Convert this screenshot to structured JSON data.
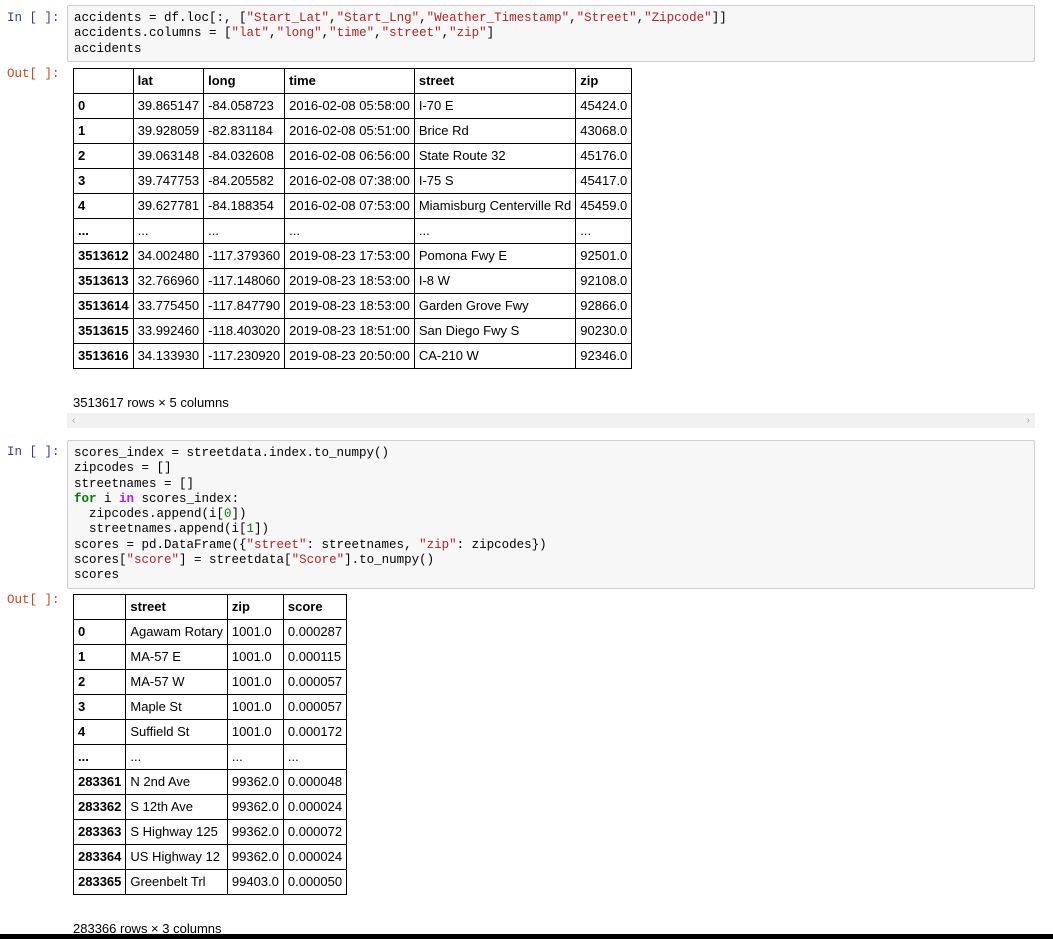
{
  "cell1": {
    "in_prompt": "In [ ]:",
    "out_prompt": "Out[ ]:",
    "code": [
      [
        {
          "t": "accidents = df.loc[:, ["
        },
        {
          "t": "\"Start_Lat\"",
          "c": "s"
        },
        {
          "t": ","
        },
        {
          "t": "\"Start_Lng\"",
          "c": "s"
        },
        {
          "t": ","
        },
        {
          "t": "\"Weather_Timestamp\"",
          "c": "s"
        },
        {
          "t": ","
        },
        {
          "t": "\"Street\"",
          "c": "s"
        },
        {
          "t": ","
        },
        {
          "t": "\"Zipcode\"",
          "c": "s"
        },
        {
          "t": "]]"
        }
      ],
      [
        {
          "t": "accidents.columns = ["
        },
        {
          "t": "\"lat\"",
          "c": "s"
        },
        {
          "t": ","
        },
        {
          "t": "\"long\"",
          "c": "s"
        },
        {
          "t": ","
        },
        {
          "t": "\"time\"",
          "c": "s"
        },
        {
          "t": ","
        },
        {
          "t": "\"street\"",
          "c": "s"
        },
        {
          "t": ","
        },
        {
          "t": "\"zip\"",
          "c": "s"
        },
        {
          "t": "]"
        }
      ],
      [
        {
          "t": "accidents"
        }
      ]
    ],
    "columns": [
      "",
      "lat",
      "long",
      "time",
      "street",
      "zip"
    ],
    "rows": [
      [
        "0",
        "39.865147",
        "-84.058723",
        "2016-02-08 05:58:00",
        "I-70 E",
        "45424.0"
      ],
      [
        "1",
        "39.928059",
        "-82.831184",
        "2016-02-08 05:51:00",
        "Brice Rd",
        "43068.0"
      ],
      [
        "2",
        "39.063148",
        "-84.032608",
        "2016-02-08 06:56:00",
        "State Route 32",
        "45176.0"
      ],
      [
        "3",
        "39.747753",
        "-84.205582",
        "2016-02-08 07:38:00",
        "I-75 S",
        "45417.0"
      ],
      [
        "4",
        "39.627781",
        "-84.188354",
        "2016-02-08 07:53:00",
        "Miamisburg Centerville Rd",
        "45459.0"
      ],
      [
        "...",
        "...",
        "...",
        "...",
        "...",
        "..."
      ],
      [
        "3513612",
        "34.002480",
        "-117.379360",
        "2019-08-23 17:53:00",
        "Pomona Fwy E",
        "92501.0"
      ],
      [
        "3513613",
        "32.766960",
        "-117.148060",
        "2019-08-23 18:53:00",
        "I-8 W",
        "92108.0"
      ],
      [
        "3513614",
        "33.775450",
        "-117.847790",
        "2019-08-23 18:53:00",
        "Garden Grove Fwy",
        "92866.0"
      ],
      [
        "3513615",
        "33.992460",
        "-118.403020",
        "2019-08-23 18:51:00",
        "San Diego Fwy S",
        "90230.0"
      ],
      [
        "3513616",
        "34.133930",
        "-117.230920",
        "2019-08-23 20:50:00",
        "CA-210 W",
        "92346.0"
      ]
    ],
    "shape": "3513617 rows × 5 columns"
  },
  "cell2": {
    "in_prompt": "In [ ]:",
    "out_prompt": "Out[ ]:",
    "code": [
      [
        {
          "t": "scores_index = streetdata.index.to_numpy()"
        }
      ],
      [
        {
          "t": "zipcodes = []"
        }
      ],
      [
        {
          "t": "streetnames = []"
        }
      ],
      [
        {
          "t": "for",
          "c": "k"
        },
        {
          "t": " i "
        },
        {
          "t": "in",
          "c": "o"
        },
        {
          "t": " scores_index:"
        }
      ],
      [
        {
          "t": "  zipcodes.append(i["
        },
        {
          "t": "0",
          "c": "k2"
        },
        {
          "t": "])"
        }
      ],
      [
        {
          "t": "  streetnames.append(i["
        },
        {
          "t": "1",
          "c": "k2"
        },
        {
          "t": "])"
        }
      ],
      [
        {
          "t": "scores = pd.DataFrame({"
        },
        {
          "t": "\"street\"",
          "c": "s"
        },
        {
          "t": ": streetnames, "
        },
        {
          "t": "\"zip\"",
          "c": "s"
        },
        {
          "t": ": zipcodes})"
        }
      ],
      [
        {
          "t": "scores["
        },
        {
          "t": "\"score\"",
          "c": "s"
        },
        {
          "t": "] = streetdata["
        },
        {
          "t": "\"Score\"",
          "c": "s"
        },
        {
          "t": "].to_numpy()"
        }
      ],
      [
        {
          "t": "scores"
        }
      ]
    ],
    "columns": [
      "",
      "street",
      "zip",
      "score"
    ],
    "rows": [
      [
        "0",
        "Agawam Rotary",
        "1001.0",
        "0.000287"
      ],
      [
        "1",
        "MA-57 E",
        "1001.0",
        "0.000115"
      ],
      [
        "2",
        "MA-57 W",
        "1001.0",
        "0.000057"
      ],
      [
        "3",
        "Maple St",
        "1001.0",
        "0.000057"
      ],
      [
        "4",
        "Suffield St",
        "1001.0",
        "0.000172"
      ],
      [
        "...",
        "...",
        "...",
        "..."
      ],
      [
        "283361",
        "N 2nd Ave",
        "99362.0",
        "0.000048"
      ],
      [
        "283362",
        "S 12th Ave",
        "99362.0",
        "0.000024"
      ],
      [
        "283363",
        "S Highway 125",
        "99362.0",
        "0.000072"
      ],
      [
        "283364",
        "US Highway 12",
        "99362.0",
        "0.000024"
      ],
      [
        "283365",
        "Greenbelt Trl",
        "99403.0",
        "0.000050"
      ]
    ],
    "shape": "283366 rows × 3 columns"
  },
  "scrollbar": {
    "left_arrow": "‹",
    "right_arrow": "›"
  },
  "colors": {
    "string": "#ba2121",
    "keyword": "#008000",
    "operator": "#aa22ff",
    "in_prompt": "#303f9f",
    "out_prompt": "#d84315"
  }
}
